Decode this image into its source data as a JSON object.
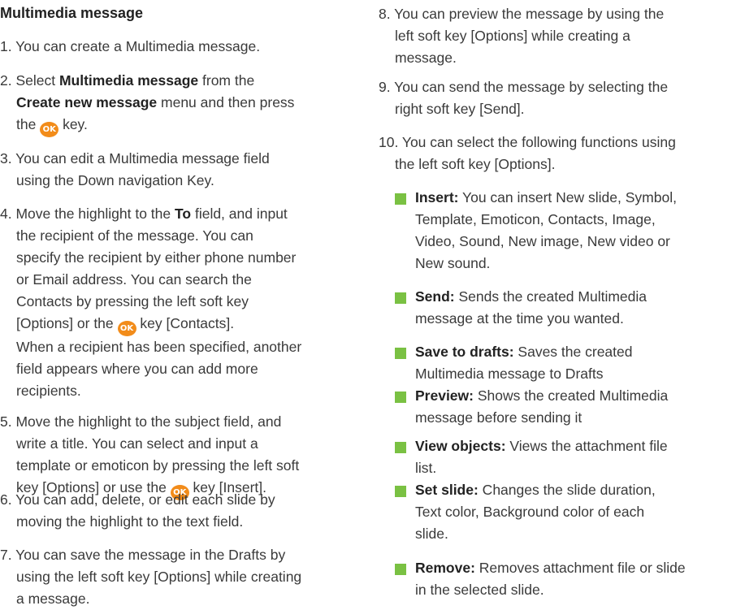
{
  "title": "Multimedia message",
  "ok_label": "OK",
  "left": {
    "s1": "1. You can create a Multimedia message.",
    "s2a": "2. Select ",
    "s2b": "Multimedia message",
    "s2c": " from the",
    "s2d": "Create new message",
    "s2e": " menu and then press",
    "s2f": "the ",
    "s2g": " key.",
    "s3a": "3. You can edit a Multimedia message field",
    "s3b": "using the Down navigation Key.",
    "s4a": "4. Move the highlight to the ",
    "s4b": "To",
    "s4c": " field, and input",
    "s4d": "the recipient of the message. You can",
    "s4e": "specify the recipient by either phone number",
    "s4f": "or Email address. You can search the",
    "s4g": "Contacts by pressing the left soft key",
    "s4h": "[Options] or the ",
    "s4i": " key [Contacts].",
    "s4j": "When a recipient has been specified, another",
    "s4k": "field appears where you can add more",
    "s4l": "recipients.",
    "s5a": "5. Move the highlight to the subject field, and",
    "s5b": "write a title. You can select and input a",
    "s5c": "template or emoticon by pressing the left soft",
    "s5d": "key [Options] or use the ",
    "s5e": " key [Insert].",
    "s6a": "6. You can add, delete, or edit each slide by",
    "s6b": "moving the highlight to the text field.",
    "s7a": "7. You can save the message in the Drafts by",
    "s7b": "using the left soft key [Options] while creating",
    "s7c": "a message."
  },
  "right": {
    "s8a": "8. You can preview the message by using the",
    "s8b": "left soft key [Options] while creating a",
    "s8c": "message.",
    "s9a": "9. You can send the message by selecting the",
    "s9b": "right soft key [Send].",
    "s10a": "10. You can select the following functions using",
    "s10b": "the left soft key [Options].",
    "bullets": [
      {
        "label": "Insert:",
        "lines": [
          " You can insert New slide, Symbol,",
          "Template, Emoticon, Contacts, Image,",
          "Video, Sound, New image, New video or",
          "New sound."
        ]
      },
      {
        "label": "Send:",
        "lines": [
          " Sends the created Multimedia",
          "message at the time you wanted."
        ]
      },
      {
        "label": "Save to drafts:",
        "lines": [
          " Saves the created",
          "Multimedia message to Drafts"
        ]
      },
      {
        "label": "Preview:",
        "lines": [
          " Shows the created Multimedia",
          "message before sending it"
        ]
      },
      {
        "label": "View objects:",
        "lines": [
          " Views the attachment file",
          "list."
        ]
      },
      {
        "label": "Set slide:",
        "lines": [
          " Changes the slide duration,",
          "Text color, Background color of each",
          "slide."
        ]
      },
      {
        "label": "Remove:",
        "lines": [
          " Removes attachment file or slide",
          "in the selected slide."
        ]
      }
    ]
  },
  "colors": {
    "bullet": "#7ac143",
    "ok_key": "#f28c1a"
  }
}
